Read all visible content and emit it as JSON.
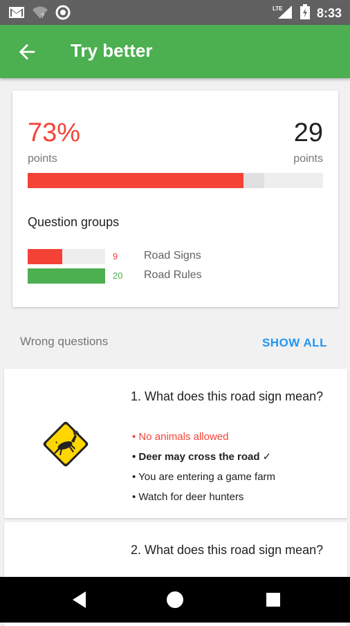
{
  "status_bar": {
    "time": "8:33",
    "network_label": "LTE",
    "icons": [
      "gmail-icon",
      "wifi-icon",
      "record-icon",
      "signal-icon",
      "battery-charging-icon"
    ]
  },
  "app_bar": {
    "title": "Try better",
    "back_icon": "arrow-left-icon"
  },
  "score": {
    "percent_text": "73%",
    "percent_label": "points",
    "points_value": "29",
    "points_label": "points",
    "progress_fraction": 0.73,
    "secondary_fraction": 0.8
  },
  "question_groups": {
    "title": "Question groups",
    "groups": [
      {
        "count": "9",
        "name": "Road Signs",
        "fraction": 0.45,
        "color": "#f44336"
      },
      {
        "count": "20",
        "name": "Road Rules",
        "fraction": 1.0,
        "color": "#4caf50"
      }
    ]
  },
  "wrong_section": {
    "title": "Wrong questions",
    "show_all": "SHOW ALL"
  },
  "questions": [
    {
      "text": "1. What does this road sign mean?",
      "image_icon": "deer-crossing-sign-icon",
      "answers": [
        {
          "text": "• No animals allowed",
          "state": "wrong"
        },
        {
          "text": "• Deer may cross the road ✓",
          "state": "correct"
        },
        {
          "text": "• You are entering a game farm",
          "state": "neutral"
        },
        {
          "text": "• Watch for deer hunters",
          "state": "neutral"
        }
      ]
    },
    {
      "text": "2. What does this road sign mean?"
    }
  ],
  "colors": {
    "primary": "#4caf50",
    "error": "#f44336",
    "accent": "#2196f3"
  }
}
